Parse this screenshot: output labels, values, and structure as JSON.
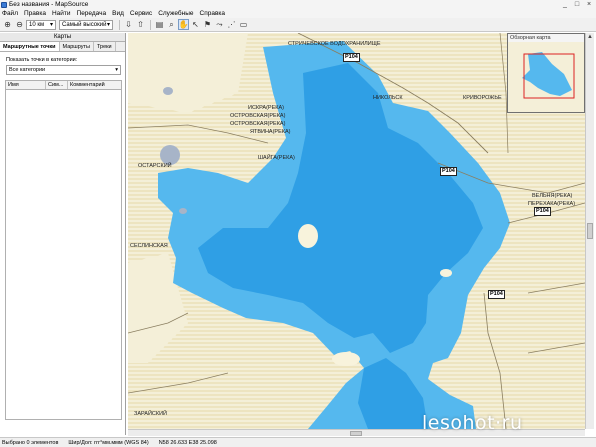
{
  "window": {
    "title": "Без названия - MapSource",
    "buttons": [
      "_",
      "□",
      "×"
    ]
  },
  "menu": {
    "items": [
      "Файл",
      "Правка",
      "Найти",
      "Передача",
      "Вид",
      "Сервис",
      "Служебные",
      "Справка"
    ]
  },
  "toolbar": {
    "zoom_level": "10 км",
    "detail_level": "Самый высокий"
  },
  "left_panel": {
    "header": "Карты",
    "tabs": [
      "Маршрутные точки",
      "Маршруты",
      "Треки"
    ],
    "filter_label": "Показать точки в категории:",
    "filter_value": "Все категории",
    "columns": [
      "Имя",
      "Сим...",
      "Комментарий"
    ]
  },
  "map": {
    "labels": [
      "СТРИЧЕВСКОЕ ВОДОХРАНИЛИЩЕ",
      "НИКОЛЬСК",
      "ИСКРА(РЕКА)",
      "ОСТРОВСКАЯ(РЕКА)",
      "ОСТРОВСКАЯ(РЕКА)",
      "ЯТВИНА(РЕКА)",
      "ШАЙГА(РЕКА)",
      "КРИВОРОЖЬЕ",
      "ВЕЛЬНЯ(РЕКА)",
      "ПЕРЕХАКА(РЕКА)",
      "ОСТАРСКИЙ",
      "СЕСЛИНСКАЯ",
      "ЗАРАЙСКИЙ"
    ],
    "road_shields": [
      "Р104",
      "Р104",
      "Р104",
      "Р104"
    ],
    "colors": {
      "water_light": "#55b8ee",
      "water_deep": "#2f9fe5",
      "land": "#f4efd8"
    }
  },
  "overview": {
    "title": "Обзорная карта"
  },
  "status": {
    "selected": "Выбрано 0 элементов",
    "format": "Шир/Дол: ггг°мм.ммм (WGS 84)",
    "coords": "N58 26.633 E38 25.098"
  },
  "watermark": "lesohot·ru"
}
